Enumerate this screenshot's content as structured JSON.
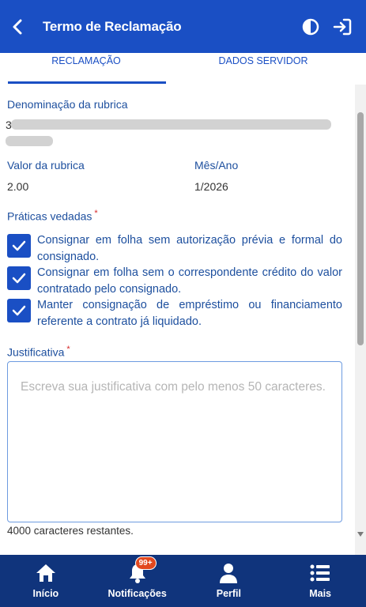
{
  "header": {
    "title": "Termo de Reclamação",
    "back_icon": "chevron-left-icon",
    "contrast_icon": "contrast-icon",
    "logout_icon": "logout-icon"
  },
  "tabs": [
    {
      "label": "RECLAMAÇÃO",
      "active": true
    },
    {
      "label": "DADOS SERVIDOR",
      "active": false
    }
  ],
  "form": {
    "rubrica_label": "Denominação da rubrica",
    "rubrica_value_prefix": "3",
    "valor_label": "Valor da rubrica",
    "valor_value": "2.00",
    "mes_label": "Mês/Ano",
    "mes_value": "1/2026",
    "praticas_label": "Práticas vedadas",
    "required_mark": "*",
    "praticas": [
      {
        "text": "Consignar em folha sem autorização prévia e formal do consignado.",
        "checked": true
      },
      {
        "text": "Consignar em folha sem o correspondente crédito do valor contratado pelo consignado.",
        "checked": true
      },
      {
        "text": "Manter consignação de empréstimo ou financiamento referente a contrato já liquidado.",
        "checked": true
      }
    ],
    "justificativa_label": "Justificativa",
    "justificativa_placeholder": "Escreva sua justificativa com pelo menos 50 caracteres.",
    "justificativa_value": "",
    "remaining_text": "4000 caracteres restantes."
  },
  "bottom_nav": [
    {
      "label": "Início",
      "icon": "home-icon"
    },
    {
      "label": "Notificações",
      "icon": "bell-icon",
      "badge": "99+"
    },
    {
      "label": "Perfil",
      "icon": "user-icon"
    },
    {
      "label": "Mais",
      "icon": "menu-list-icon"
    }
  ],
  "colors": {
    "primary": "#1a4fc4",
    "nav_bg": "#10347c",
    "label_text": "#1d4f9e",
    "required": "#d62828",
    "badge": "#e2481f"
  }
}
